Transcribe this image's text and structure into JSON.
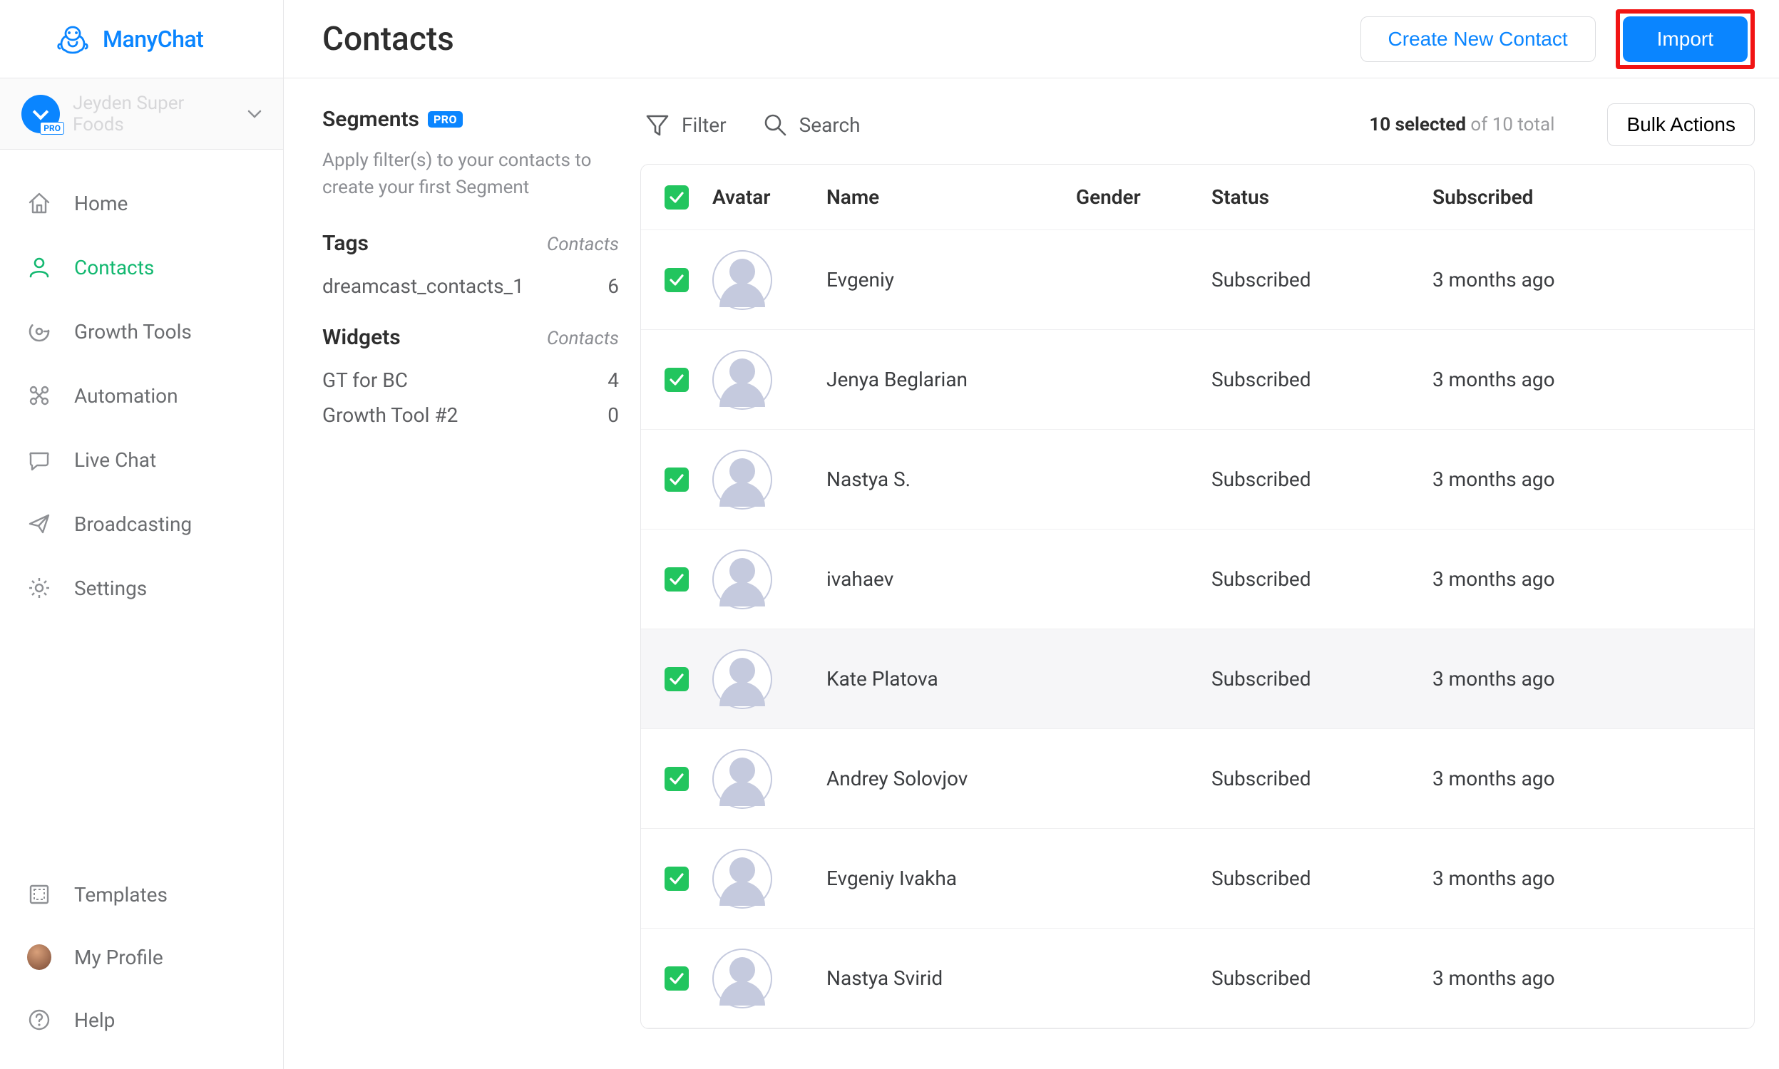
{
  "brand": {
    "name": "ManyChat"
  },
  "workspace": {
    "name": "Jeyden Super Foods",
    "badge": "PRO"
  },
  "nav": {
    "home": "Home",
    "contacts": "Contacts",
    "growth_tools": "Growth Tools",
    "automation": "Automation",
    "live_chat": "Live Chat",
    "broadcasting": "Broadcasting",
    "settings": "Settings",
    "templates": "Templates",
    "my_profile": "My Profile",
    "help": "Help"
  },
  "page": {
    "title": "Contacts"
  },
  "actions": {
    "create": "Create New Contact",
    "import": "Import",
    "bulk": "Bulk Actions",
    "filter": "Filter",
    "search": "Search"
  },
  "selection": {
    "selected_text": "10 selected",
    "of_total_text": " of 10 total"
  },
  "segments": {
    "title": "Segments",
    "badge": "PRO",
    "hint": "Apply filter(s) to your contacts to create your first Segment",
    "tags_title": "Tags",
    "tags_count_label": "Contacts",
    "tags": [
      {
        "name": "dreamcast_contacts_1",
        "count": "6"
      }
    ],
    "widgets_title": "Widgets",
    "widgets_count_label": "Contacts",
    "widgets": [
      {
        "name": "GT for BC",
        "count": "4"
      },
      {
        "name": "Growth Tool #2",
        "count": "0"
      }
    ]
  },
  "table": {
    "headers": {
      "avatar": "Avatar",
      "name": "Name",
      "gender": "Gender",
      "status": "Status",
      "subscribed": "Subscribed"
    },
    "rows": [
      {
        "name": "Evgeniy",
        "gender": "",
        "status": "Subscribed",
        "subscribed": "3 months ago",
        "highlight": false
      },
      {
        "name": "Jenya Beglarian",
        "gender": "",
        "status": "Subscribed",
        "subscribed": "3 months ago",
        "highlight": false
      },
      {
        "name": "Nastya S.",
        "gender": "",
        "status": "Subscribed",
        "subscribed": "3 months ago",
        "highlight": false
      },
      {
        "name": "ivahaev",
        "gender": "",
        "status": "Subscribed",
        "subscribed": "3 months ago",
        "highlight": false
      },
      {
        "name": "Kate Platova",
        "gender": "",
        "status": "Subscribed",
        "subscribed": "3 months ago",
        "highlight": true
      },
      {
        "name": "Andrey Solovjov",
        "gender": "",
        "status": "Subscribed",
        "subscribed": "3 months ago",
        "highlight": false
      },
      {
        "name": "Evgeniy Ivakha",
        "gender": "",
        "status": "Subscribed",
        "subscribed": "3 months ago",
        "highlight": false
      },
      {
        "name": "Nastya Svirid",
        "gender": "",
        "status": "Subscribed",
        "subscribed": "3 months ago",
        "highlight": false
      }
    ]
  }
}
